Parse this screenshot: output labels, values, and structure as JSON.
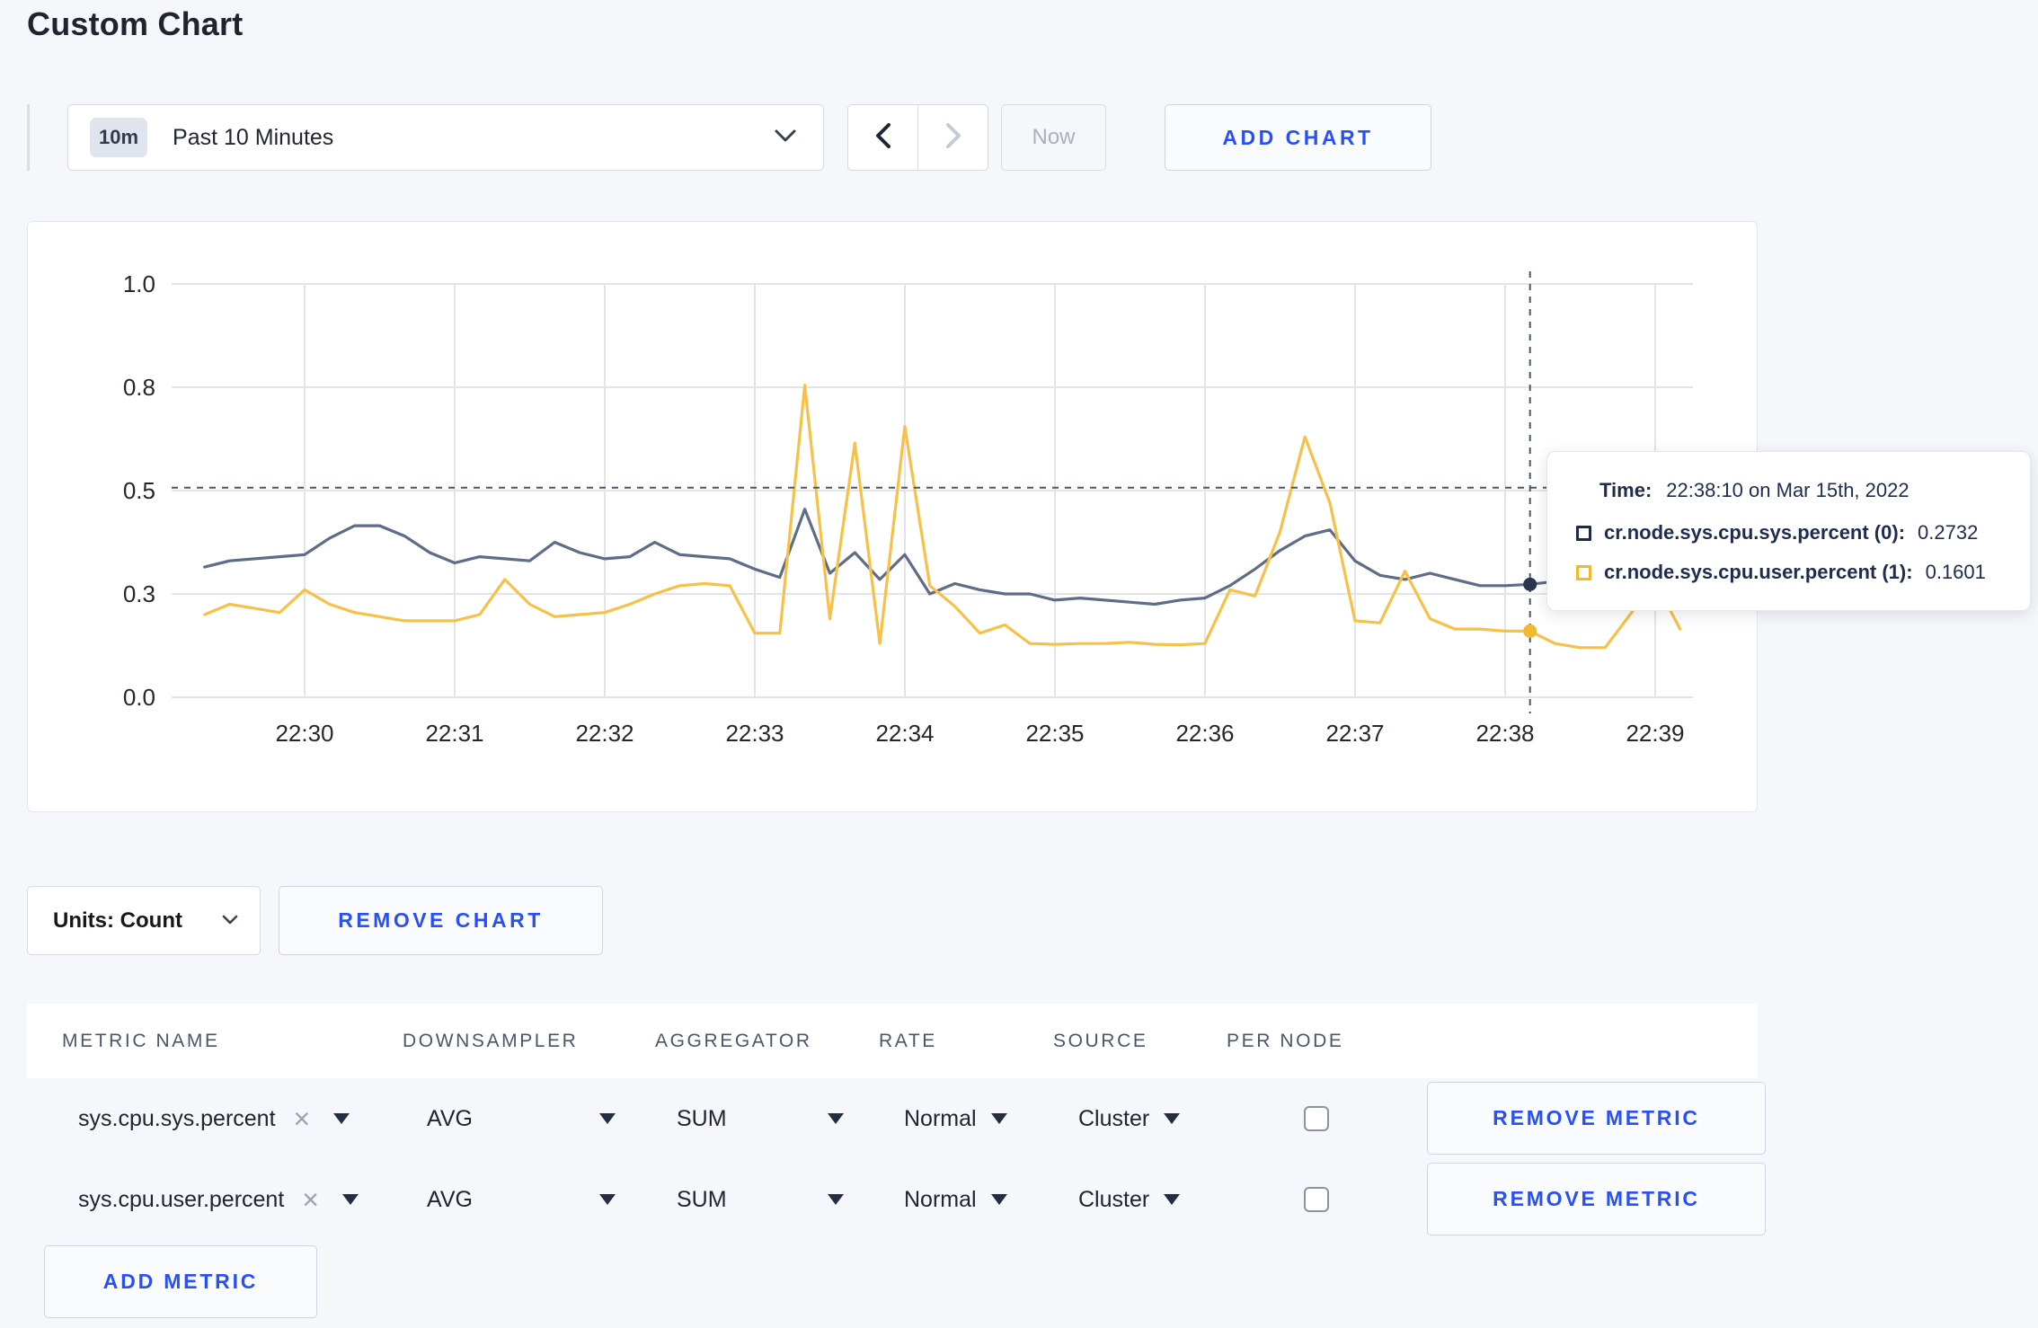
{
  "page": {
    "title": "Custom Chart",
    "background": "#f5f7fa",
    "accent_blue": "#2850f5"
  },
  "toolbar": {
    "time_range": {
      "badge": "10m",
      "label": "Past 10 Minutes"
    },
    "prev_icon": "chevron-left",
    "next_icon": "chevron-right",
    "now_label": "Now",
    "add_chart_label": "ADD CHART"
  },
  "chart_data": {
    "type": "line",
    "title": "",
    "xlabel": "",
    "ylabel": "",
    "ylim": [
      0,
      1
    ],
    "grid": true,
    "x_start": "22:29:20",
    "x_interval_seconds": 10,
    "x_tick_labels": [
      "22:30",
      "22:31",
      "22:32",
      "22:33",
      "22:34",
      "22:35",
      "22:36",
      "22:37",
      "22:38",
      "22:39"
    ],
    "y_ticks": [
      {
        "v": 0.0,
        "label": "0.0"
      },
      {
        "v": 0.25,
        "label": "0.3"
      },
      {
        "v": 0.5,
        "label": "0.5"
      },
      {
        "v": 0.75,
        "label": "0.8"
      },
      {
        "v": 1.0,
        "label": "1.0"
      }
    ],
    "series": [
      {
        "name": "cr.node.sys.cpu.sys.percent",
        "color": "#5f6c87",
        "dot_color": "#2a3650",
        "values": [
          0.315,
          0.33,
          0.335,
          0.34,
          0.345,
          0.385,
          0.415,
          0.415,
          0.39,
          0.35,
          0.325,
          0.34,
          0.335,
          0.33,
          0.375,
          0.35,
          0.335,
          0.34,
          0.375,
          0.345,
          0.34,
          0.335,
          0.31,
          0.29,
          0.455,
          0.3,
          0.35,
          0.285,
          0.345,
          0.25,
          0.275,
          0.26,
          0.25,
          0.25,
          0.235,
          0.24,
          0.235,
          0.23,
          0.225,
          0.235,
          0.24,
          0.27,
          0.31,
          0.355,
          0.39,
          0.405,
          0.33,
          0.295,
          0.285,
          0.3,
          0.285,
          0.27,
          0.27,
          0.2732,
          0.28,
          0.285,
          0.28,
          0.285,
          0.29,
          0.3
        ]
      },
      {
        "name": "cr.node.sys.cpu.user.percent",
        "color": "#f7c148",
        "dot_color": "#f2b92e",
        "values": [
          0.2,
          0.225,
          0.215,
          0.205,
          0.26,
          0.225,
          0.205,
          0.195,
          0.185,
          0.185,
          0.185,
          0.2,
          0.285,
          0.225,
          0.195,
          0.2,
          0.205,
          0.225,
          0.25,
          0.27,
          0.275,
          0.27,
          0.155,
          0.155,
          0.755,
          0.19,
          0.615,
          0.13,
          0.655,
          0.27,
          0.22,
          0.155,
          0.175,
          0.13,
          0.128,
          0.13,
          0.13,
          0.133,
          0.128,
          0.127,
          0.13,
          0.26,
          0.245,
          0.4,
          0.63,
          0.47,
          0.185,
          0.18,
          0.305,
          0.19,
          0.165,
          0.165,
          0.16,
          0.1601,
          0.13,
          0.12,
          0.12,
          0.2,
          0.28,
          0.165
        ]
      }
    ],
    "legend_position": "tooltip-only",
    "crosshair": {
      "index": 53,
      "time": "22:38:10",
      "y_value": 0.507
    }
  },
  "tooltip": {
    "time_label": "Time:",
    "time_value": "22:38:10 on Mar 15th, 2022",
    "rows": [
      {
        "name": "cr.node.sys.cpu.sys.percent (0):",
        "value": "0.2732",
        "color": "#1c2b4a"
      },
      {
        "name": "cr.node.sys.cpu.user.percent (1):",
        "value": "0.1601",
        "color": "#f1b927"
      }
    ]
  },
  "chart_controls": {
    "units_label": "Units: Count",
    "remove_chart_label": "REMOVE CHART"
  },
  "metrics_table": {
    "headers": [
      "METRIC NAME",
      "DOWNSAMPLER",
      "AGGREGATOR",
      "RATE",
      "SOURCE",
      "PER NODE"
    ],
    "rows": [
      {
        "metric": "sys.cpu.sys.percent",
        "downsampler": "AVG",
        "aggregator": "SUM",
        "rate": "Normal",
        "source": "Cluster",
        "per_node_checked": false,
        "remove_label": "REMOVE METRIC"
      },
      {
        "metric": "sys.cpu.user.percent",
        "downsampler": "AVG",
        "aggregator": "SUM",
        "rate": "Normal",
        "source": "Cluster",
        "per_node_checked": false,
        "remove_label": "REMOVE METRIC"
      }
    ],
    "add_metric_label": "ADD METRIC"
  }
}
